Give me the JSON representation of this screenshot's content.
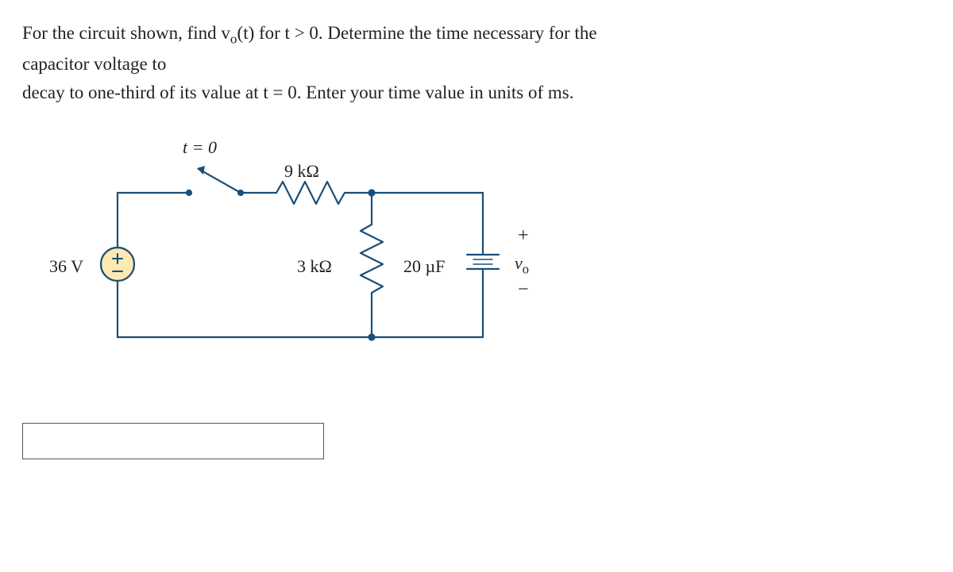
{
  "problem": {
    "line1_pre": "For the circuit shown, find v",
    "line1_sub": "o",
    "line1_post": "(t) for t > 0. Determine the time necessary for the",
    "line2": "capacitor voltage to",
    "line3": "decay to one-third of its value at t = 0. Enter your time value in units of ms."
  },
  "circuit": {
    "switch_label": "t = 0",
    "r1_label": "9 kΩ",
    "r2_label": "3 kΩ",
    "c_label": "20 µF",
    "source_label": "36 V",
    "vo_plus": "+",
    "vo_minus": "−",
    "vo_symbol_v": "v",
    "vo_symbol_o": "o"
  },
  "answer": {
    "value": "",
    "placeholder": ""
  }
}
